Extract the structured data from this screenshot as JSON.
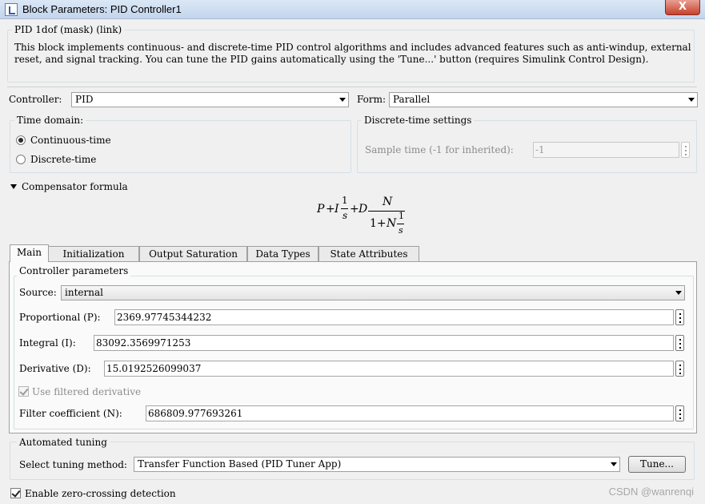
{
  "window": {
    "title": "Block Parameters: PID Controller1",
    "close_glyph": "X"
  },
  "mask": {
    "header": "PID 1dof (mask) (link)",
    "description": "This block implements continuous- and discrete-time PID control algorithms and includes advanced features such as anti-windup, external reset, and signal tracking. You can tune the PID gains automatically using the 'Tune...' button (requires Simulink Control Design)."
  },
  "controller": {
    "label": "Controller:",
    "value": "PID"
  },
  "form": {
    "label": "Form:",
    "value": "Parallel"
  },
  "time_domain": {
    "label": "Time domain:",
    "options": [
      {
        "label": "Continuous-time",
        "selected": true
      },
      {
        "label": "Discrete-time",
        "selected": false
      }
    ]
  },
  "discrete_settings": {
    "label": "Discrete-time settings",
    "sample_time_label": "Sample time (-1 for inherited):",
    "sample_time_value": "-1"
  },
  "compensator": {
    "label": "Compensator formula",
    "formula": {
      "P": "P",
      "plus": "+",
      "I": "I",
      "one": "1",
      "s": "s",
      "D": "D",
      "N": "N",
      "one_plus": "1+"
    }
  },
  "tabs": [
    {
      "label": "Main",
      "active": true
    },
    {
      "label": "Initialization",
      "active": false
    },
    {
      "label": "Output Saturation",
      "active": false
    },
    {
      "label": "Data Types",
      "active": false
    },
    {
      "label": "State Attributes",
      "active": false
    }
  ],
  "controller_params": {
    "label": "Controller parameters",
    "source_label": "Source:",
    "source_value": "internal",
    "proportional_label": "Proportional (P):",
    "proportional_value": "2369.97745344232",
    "integral_label": "Integral (I):",
    "integral_value": "83092.3569971253",
    "derivative_label": "Derivative (D):",
    "derivative_value": "15.0192526099037",
    "filtered_label": "Use filtered derivative",
    "filtered_checked": true,
    "filter_label": "Filter coefficient (N):",
    "filter_value": "686809.977693261"
  },
  "auto_tuning": {
    "label": "Automated tuning",
    "method_label": "Select tuning method:",
    "method_value": "Transfer Function Based (PID Tuner App)",
    "tune_button": "Tune..."
  },
  "zero_crossing": {
    "label": "Enable zero-crossing detection",
    "checked": true
  },
  "watermark": "CSDN @wanrenqi"
}
